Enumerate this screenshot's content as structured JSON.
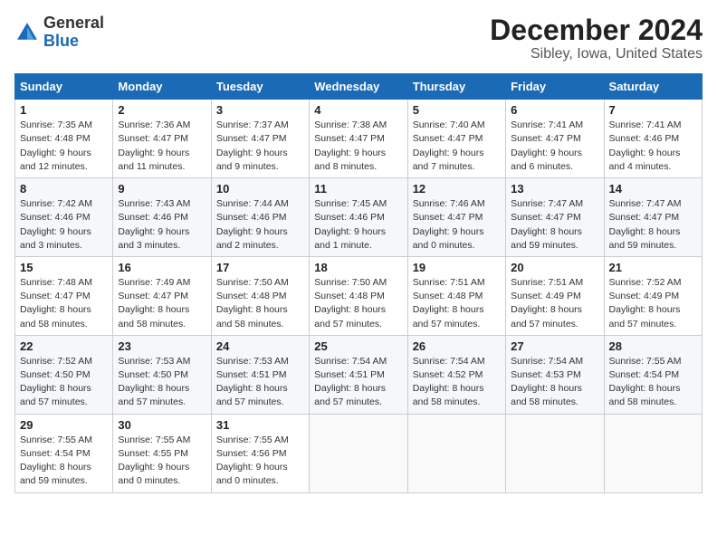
{
  "header": {
    "logo_general": "General",
    "logo_blue": "Blue",
    "month": "December 2024",
    "location": "Sibley, Iowa, United States"
  },
  "days_of_week": [
    "Sunday",
    "Monday",
    "Tuesday",
    "Wednesday",
    "Thursday",
    "Friday",
    "Saturday"
  ],
  "weeks": [
    [
      {
        "day": "1",
        "info": "Sunrise: 7:35 AM\nSunset: 4:48 PM\nDaylight: 9 hours\nand 12 minutes."
      },
      {
        "day": "2",
        "info": "Sunrise: 7:36 AM\nSunset: 4:47 PM\nDaylight: 9 hours\nand 11 minutes."
      },
      {
        "day": "3",
        "info": "Sunrise: 7:37 AM\nSunset: 4:47 PM\nDaylight: 9 hours\nand 9 minutes."
      },
      {
        "day": "4",
        "info": "Sunrise: 7:38 AM\nSunset: 4:47 PM\nDaylight: 9 hours\nand 8 minutes."
      },
      {
        "day": "5",
        "info": "Sunrise: 7:40 AM\nSunset: 4:47 PM\nDaylight: 9 hours\nand 7 minutes."
      },
      {
        "day": "6",
        "info": "Sunrise: 7:41 AM\nSunset: 4:47 PM\nDaylight: 9 hours\nand 6 minutes."
      },
      {
        "day": "7",
        "info": "Sunrise: 7:41 AM\nSunset: 4:46 PM\nDaylight: 9 hours\nand 4 minutes."
      }
    ],
    [
      {
        "day": "8",
        "info": "Sunrise: 7:42 AM\nSunset: 4:46 PM\nDaylight: 9 hours\nand 3 minutes."
      },
      {
        "day": "9",
        "info": "Sunrise: 7:43 AM\nSunset: 4:46 PM\nDaylight: 9 hours\nand 3 minutes."
      },
      {
        "day": "10",
        "info": "Sunrise: 7:44 AM\nSunset: 4:46 PM\nDaylight: 9 hours\nand 2 minutes."
      },
      {
        "day": "11",
        "info": "Sunrise: 7:45 AM\nSunset: 4:46 PM\nDaylight: 9 hours\nand 1 minute."
      },
      {
        "day": "12",
        "info": "Sunrise: 7:46 AM\nSunset: 4:47 PM\nDaylight: 9 hours\nand 0 minutes."
      },
      {
        "day": "13",
        "info": "Sunrise: 7:47 AM\nSunset: 4:47 PM\nDaylight: 8 hours\nand 59 minutes."
      },
      {
        "day": "14",
        "info": "Sunrise: 7:47 AM\nSunset: 4:47 PM\nDaylight: 8 hours\nand 59 minutes."
      }
    ],
    [
      {
        "day": "15",
        "info": "Sunrise: 7:48 AM\nSunset: 4:47 PM\nDaylight: 8 hours\nand 58 minutes."
      },
      {
        "day": "16",
        "info": "Sunrise: 7:49 AM\nSunset: 4:47 PM\nDaylight: 8 hours\nand 58 minutes."
      },
      {
        "day": "17",
        "info": "Sunrise: 7:50 AM\nSunset: 4:48 PM\nDaylight: 8 hours\nand 58 minutes."
      },
      {
        "day": "18",
        "info": "Sunrise: 7:50 AM\nSunset: 4:48 PM\nDaylight: 8 hours\nand 57 minutes."
      },
      {
        "day": "19",
        "info": "Sunrise: 7:51 AM\nSunset: 4:48 PM\nDaylight: 8 hours\nand 57 minutes."
      },
      {
        "day": "20",
        "info": "Sunrise: 7:51 AM\nSunset: 4:49 PM\nDaylight: 8 hours\nand 57 minutes."
      },
      {
        "day": "21",
        "info": "Sunrise: 7:52 AM\nSunset: 4:49 PM\nDaylight: 8 hours\nand 57 minutes."
      }
    ],
    [
      {
        "day": "22",
        "info": "Sunrise: 7:52 AM\nSunset: 4:50 PM\nDaylight: 8 hours\nand 57 minutes."
      },
      {
        "day": "23",
        "info": "Sunrise: 7:53 AM\nSunset: 4:50 PM\nDaylight: 8 hours\nand 57 minutes."
      },
      {
        "day": "24",
        "info": "Sunrise: 7:53 AM\nSunset: 4:51 PM\nDaylight: 8 hours\nand 57 minutes."
      },
      {
        "day": "25",
        "info": "Sunrise: 7:54 AM\nSunset: 4:51 PM\nDaylight: 8 hours\nand 57 minutes."
      },
      {
        "day": "26",
        "info": "Sunrise: 7:54 AM\nSunset: 4:52 PM\nDaylight: 8 hours\nand 58 minutes."
      },
      {
        "day": "27",
        "info": "Sunrise: 7:54 AM\nSunset: 4:53 PM\nDaylight: 8 hours\nand 58 minutes."
      },
      {
        "day": "28",
        "info": "Sunrise: 7:55 AM\nSunset: 4:54 PM\nDaylight: 8 hours\nand 58 minutes."
      }
    ],
    [
      {
        "day": "29",
        "info": "Sunrise: 7:55 AM\nSunset: 4:54 PM\nDaylight: 8 hours\nand 59 minutes."
      },
      {
        "day": "30",
        "info": "Sunrise: 7:55 AM\nSunset: 4:55 PM\nDaylight: 9 hours\nand 0 minutes."
      },
      {
        "day": "31",
        "info": "Sunrise: 7:55 AM\nSunset: 4:56 PM\nDaylight: 9 hours\nand 0 minutes."
      },
      null,
      null,
      null,
      null
    ]
  ]
}
